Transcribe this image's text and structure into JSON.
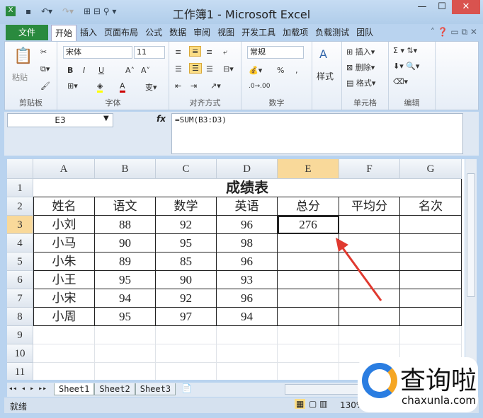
{
  "window": {
    "title": "工作簿1 - Microsoft Excel",
    "minimize": "—",
    "maximize": "☐",
    "close": "✕"
  },
  "ribbon_tabs": [
    "文件",
    "开始",
    "插入",
    "页面布局",
    "公式",
    "数据",
    "审阅",
    "视图",
    "开发工具",
    "加载项",
    "负载测试",
    "团队"
  ],
  "active_tab": "开始",
  "ribbon": {
    "clipboard": {
      "label": "剪贴板",
      "paste": "粘贴"
    },
    "font": {
      "label": "字体",
      "name": "宋体",
      "size": "11",
      "bold": "B",
      "italic": "I",
      "underline": "U",
      "grow": "A˄",
      "shrink": "A˅"
    },
    "alignment": {
      "label": "对齐方式"
    },
    "number": {
      "label": "数字",
      "format": "常规",
      "percent": "%",
      "comma": ","
    },
    "styles": {
      "label": "样式"
    },
    "cells": {
      "label": "单元格",
      "insert": "插入",
      "delete": "删除",
      "format": "格式"
    },
    "editing": {
      "label": "编辑",
      "sum": "Σ"
    }
  },
  "formula_bar": {
    "name_box": "E3",
    "fx": "fx",
    "formula": "=SUM(B3:D3)"
  },
  "columns": [
    "A",
    "B",
    "C",
    "D",
    "E",
    "F",
    "G"
  ],
  "rows": [
    "1",
    "2",
    "3",
    "4",
    "5",
    "6",
    "7",
    "8",
    "9",
    "10",
    "11"
  ],
  "sheet": {
    "title": "成绩表",
    "headers": [
      "姓名",
      "语文",
      "数学",
      "英语",
      "总分",
      "平均分",
      "名次"
    ],
    "data": [
      [
        "小刘",
        "88",
        "92",
        "96",
        "276",
        "",
        ""
      ],
      [
        "小马",
        "90",
        "95",
        "98",
        "",
        "",
        ""
      ],
      [
        "小朱",
        "89",
        "85",
        "96",
        "",
        "",
        ""
      ],
      [
        "小王",
        "95",
        "90",
        "93",
        "",
        "",
        ""
      ],
      [
        "小宋",
        "94",
        "92",
        "96",
        "",
        "",
        ""
      ],
      [
        "小周",
        "95",
        "97",
        "94",
        "",
        "",
        ""
      ]
    ],
    "selected_cell": "E3"
  },
  "sheet_tabs": [
    "Sheet1",
    "Sheet2",
    "Sheet3"
  ],
  "active_sheet": "Sheet1",
  "status": {
    "text": "就绪",
    "zoom": "130%"
  },
  "watermark": {
    "text": "查询啦",
    "url": "chaxunla.com"
  },
  "colors": {
    "file_tab": "#2a8a3e",
    "arrow": "#e0392f",
    "selection": "#217346"
  }
}
